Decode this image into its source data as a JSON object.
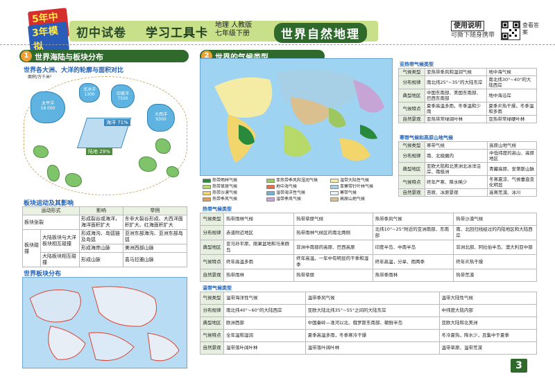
{
  "header": {
    "logo_line1": "5年中考",
    "logo_line2": "3年模拟",
    "title_main": "初中试卷",
    "title_sub": "学习工具卡",
    "edition_line1": "地理 人教版",
    "edition_line2": "七年级下册",
    "title_right": "世界自然地理",
    "usage_title": "使用说明",
    "usage_desc": "可撕下随身携带",
    "qr_label": "查看答案"
  },
  "left": {
    "section_num": "1",
    "section_title": "世界海陆与板块分布",
    "sub1": "世界各大洲、大洋的轮廓与面积对比",
    "ocean_labels": {
      "continent_caption": "面积/万千米²",
      "pacific": "太平洋\n18 000",
      "indian": "印度洋\n7500",
      "arctic": "北冰洋\n1300",
      "atlantic": "大西洋\n9300",
      "ocean_pct": "海洋 71%",
      "land_pct": "陆地 29%"
    },
    "sub2": "板块运动及其影响",
    "plate_table": {
      "headers": [
        "运动形式",
        "影响",
        "举例"
      ],
      "rows": [
        [
          "板块张裂",
          "形成裂谷或海洋，海洋面积扩大",
          "东非大裂谷形成、大西洋面积扩大、红海面积扩大"
        ],
        [
          "板块碰撞",
          "大陆板块与大洋板块相互碰撞",
          "形成海沟、岛弧链及岛弧",
          "亚洲东部海沟、亚洲东部岛弧"
        ],
        [
          "",
          "",
          "形成海岸山脉",
          "美洲西部山脉"
        ],
        [
          "",
          "大陆板块相互碰撞",
          "形成山脉",
          "喜马拉雅山脉"
        ]
      ]
    },
    "sub3": "世界板块分布"
  },
  "right": {
    "section_num": "2",
    "section_title": "世界的气候类型",
    "legend": [
      {
        "label": "热带雨林气候",
        "color": "#2a8a3c"
      },
      {
        "label": "热带草原气候",
        "color": "#b7d96a"
      },
      {
        "label": "热带沙漠气候",
        "color": "#f2d56b"
      },
      {
        "label": "热带季风气候",
        "color": "#d9a05a"
      },
      {
        "label": "亚热带季风和湿润气候",
        "color": "#9ec760"
      },
      {
        "label": "地中海气候",
        "color": "#e66f4a"
      },
      {
        "label": "温带海洋性气候",
        "color": "#6fb2d6"
      },
      {
        "label": "温带季风气候",
        "color": "#c7a4d6"
      },
      {
        "label": "温带大陆性气候",
        "color": "#f4eba5"
      },
      {
        "label": "亚寒带针叶林气候",
        "color": "#a7cfe6"
      },
      {
        "label": "寒带气候",
        "color": "#e8f3fa"
      },
      {
        "label": "高原山地气候",
        "color": "#d9c08e"
      }
    ],
    "subtropical": {
      "caption": "亚热带气候类型",
      "rows": [
        [
          "气候类型",
          "亚热带季风和湿润气候",
          "地中海气候"
        ],
        [
          "分布规律",
          "南北纬25°~35°的大陆东岸",
          "南北纬30°~40°的大陆西岸"
        ],
        [
          "典型地区",
          "中国东南部、美国东南部、巴西东南部",
          "地中海沿岸"
        ],
        [
          "气候特点",
          "夏季高温多雨，冬季温和少雨",
          "夏季炎热干燥，冬季温和多雨"
        ],
        [
          "自然景观",
          "亚热带常绿阔叶林",
          "亚热带常绿硬叶林"
        ]
      ]
    },
    "cold": {
      "caption": "寒带气候和高原山地气候",
      "rows": [
        [
          "气候类型",
          "寒带气候",
          "高原山地气候"
        ],
        [
          "分布规律",
          "南、北极圈内",
          "中低纬度的高山、高原地区"
        ],
        [
          "典型地区",
          "亚欧大陆和北美洲北冰洋沿岸、南极洲",
          "青藏高原、安第斯山脉"
        ],
        [
          "气候特点",
          "终年严寒、降水稀少",
          "冬寒夏凉、气候垂直变化明显"
        ],
        [
          "自然景观",
          "苔原、冰原景观",
          "高寒荒漠、冰川"
        ]
      ]
    },
    "tropical": {
      "caption": "热带气候类型",
      "rows": [
        [
          "气候类型",
          "热带雨林气候",
          "热带草原气候",
          "热带季风气候",
          "热带沙漠气候"
        ],
        [
          "分布规律",
          "赤道附近地区",
          "热带雨林气候区的南北两侧",
          "北纬10°~25°附近的亚洲南部、东南部",
          "南、北回归线经过的内陆地区和大陆西岸"
        ],
        [
          "典型地区",
          "亚马孙平原、刚果盆地和马来群岛",
          "非洲中南部的高原、巴西高原",
          "印度半岛、中南半岛",
          "非洲北部、阿拉伯半岛、澳大利亚中部"
        ],
        [
          "气候特点",
          "终年高温多雨",
          "终年高温，一年中有明显的干季和湿季",
          "终年高温，分旱、雨两季",
          "终年炎热干燥"
        ],
        [
          "自然景观",
          "热带雨林",
          "热带草原",
          "热带季雨林",
          "热带荒漠"
        ]
      ]
    },
    "temperate": {
      "caption": "温带气候类型",
      "rows": [
        [
          "气候类型",
          "温带海洋性气候",
          "温带季风气候",
          "温带大陆性气候"
        ],
        [
          "分布规律",
          "南北纬40°~60°的大陆西岸",
          "亚欧大陆北纬35°~55°之间的大陆东岸",
          "中纬度大陆内部"
        ],
        [
          "典型地区",
          "欧洲西部",
          "中国秦岭—淮河以北、俄罗斯东南部、朝鲜半岛",
          "亚欧大陆和北美洲"
        ],
        [
          "气候特点",
          "全年温和湿润",
          "夏季高温多雨，冬季寒冷干燥",
          "冬冷夏热，降水少，且集中于夏季"
        ],
        [
          "自然景观",
          "温带落叶阔叶林",
          "温带落叶阔叶林",
          "温带草原、温带荒漠"
        ]
      ]
    }
  },
  "page_number": "3"
}
